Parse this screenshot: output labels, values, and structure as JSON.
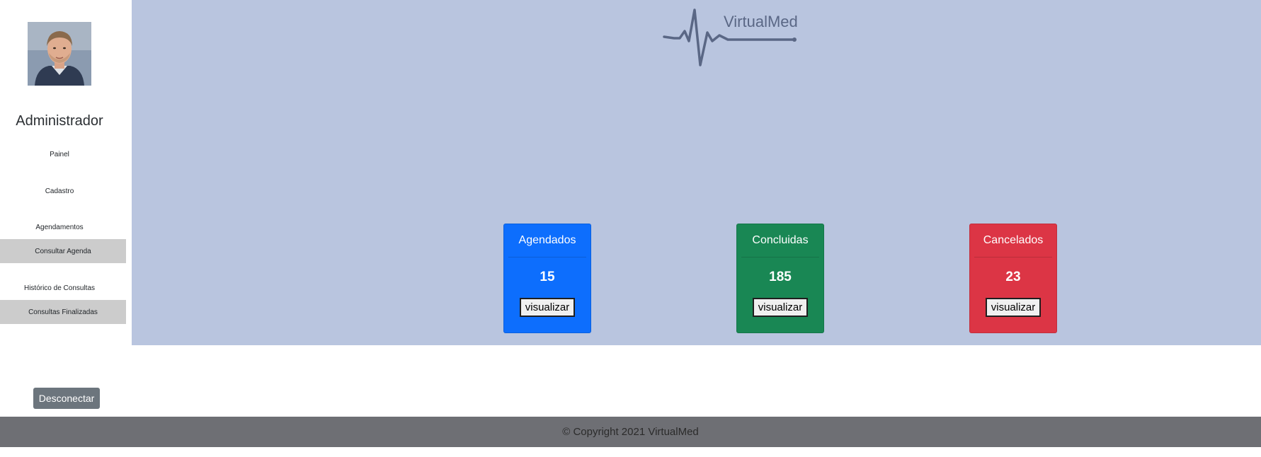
{
  "sidebar": {
    "role_title": "Administrador",
    "links": {
      "painel": "Painel",
      "cadastro": "Cadastro",
      "agendamentos": "Agendamentos",
      "consultar_agenda": "Consultar Agenda",
      "historico": "Histórico de Consultas",
      "consultas_finalizadas": "Consultas Finalizadas"
    },
    "logout_label": "Desconectar"
  },
  "header": {
    "logo_text": "VirtualMed"
  },
  "cards": [
    {
      "title": "Agendados",
      "count": "15",
      "button": "visualizar",
      "color": "#0d6efd"
    },
    {
      "title": "Concluidas",
      "count": "185",
      "button": "visualizar",
      "color": "#198754"
    },
    {
      "title": "Cancelados",
      "count": "23",
      "button": "visualizar",
      "color": "#dc3545"
    }
  ],
  "footer": {
    "copyright": "© Copyright 2021 VirtualMed"
  },
  "colors": {
    "main_background": "#b9c5df",
    "sidebar_sub_background": "#cccccc",
    "footer_background": "#6e6f74",
    "logout_button": "#6c757d"
  },
  "icons": {
    "avatar": "user-avatar-photo",
    "logo": "heartbeat-line-logo"
  }
}
